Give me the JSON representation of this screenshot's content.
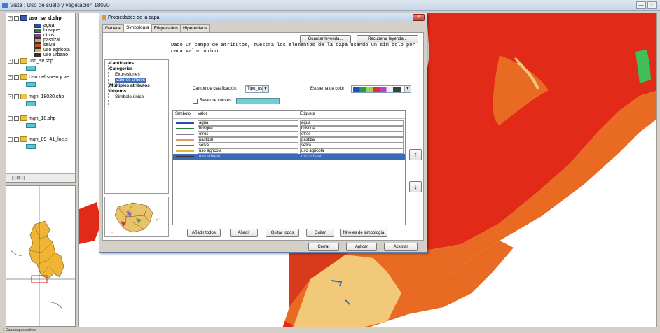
{
  "window": {
    "title": "Vista : Uso de suelo y vegetacion 18020",
    "minimize": "—",
    "maximize": "□"
  },
  "toc": {
    "layers": [
      {
        "name": "uso_sv_d.shp",
        "selected": true
      },
      {
        "name": "uso_sv.shp"
      },
      {
        "name": "Uso del suelo y ve"
      },
      {
        "name": "mgn_18020.shp"
      },
      {
        "name": "mgn_18.shp"
      },
      {
        "name": "mgn_09+41_loc.s"
      }
    ],
    "legend": [
      {
        "label": "agua",
        "color": "#2a4fa8"
      },
      {
        "label": "bosque",
        "color": "#2f7d3c"
      },
      {
        "label": "otros",
        "color": "#7a4b8c"
      },
      {
        "label": "pastizal",
        "color": "#d9a063"
      },
      {
        "label": "selva",
        "color": "#c95025"
      },
      {
        "label": "uso agricola",
        "color": "#e0b53a"
      },
      {
        "label": "uso urbano",
        "color": "#333333"
      }
    ],
    "scroll_label": "|||"
  },
  "dialog": {
    "title": "Propiedades de la capa",
    "close": "✕",
    "tabs": [
      "General",
      "Simbología",
      "Etiquetados",
      "Hiperenlace"
    ],
    "buttons": {
      "save_legend": "Guardar leyenda...",
      "load_legend": "Recuperar leyenda...",
      "add_all": "Añadir todos",
      "add": "Añadir",
      "remove_all": "Quitar todos",
      "remove": "Quitar",
      "levels": "Niveles de simbología",
      "cancel": "Cerrar",
      "apply": "Aplicar",
      "accept": "Aceptar"
    },
    "tree": [
      {
        "label": "Cantidades",
        "bold": true
      },
      {
        "label": "Categorías",
        "bold": true
      },
      {
        "label": "Expresiones"
      },
      {
        "label": "Valores únicos",
        "selected": true
      },
      {
        "label": "Múltiples atributos",
        "bold": true
      },
      {
        "label": "Objetos",
        "bold": true
      },
      {
        "label": "Símbolo único"
      }
    ],
    "description": "Dado un campo de atributos, muestra los elementos de la capa usando un sim bolo por cada valor único.",
    "classification_label": "Campo de clasificación:",
    "classification_field": "Tipo_usv",
    "color_scheme_label": "Esquema de color:",
    "rest_label": "Resto de valores:",
    "columns": [
      "Símbolo",
      "Valor",
      "Etiqueta"
    ],
    "rows": [
      {
        "value": "agua",
        "label": "agua",
        "color": "#2a4fa8"
      },
      {
        "value": "bosque",
        "label": "bosque",
        "color": "#2f7d3c"
      },
      {
        "value": "otros",
        "label": "otros",
        "color": "#8a7aa0"
      },
      {
        "value": "pastizal",
        "label": "pastizal",
        "color": "#d9a063"
      },
      {
        "value": "selva",
        "label": "selva",
        "color": "#c95025"
      },
      {
        "value": "uso agricola",
        "label": "uso agricola",
        "color": "#e0b53a"
      },
      {
        "value": "uso urbano",
        "label": "uso urbano",
        "color": "#333333",
        "selected": true
      }
    ],
    "move_up": "🡅",
    "move_down": "🡇"
  },
  "status": {
    "text": "1 Capa/capas activas"
  },
  "colors": {
    "selection": "#3b6bb7",
    "map_red": "#e12b18",
    "map_orange": "#e86a23",
    "map_tan": "#f2c879",
    "map_green": "#3fbf5a"
  }
}
